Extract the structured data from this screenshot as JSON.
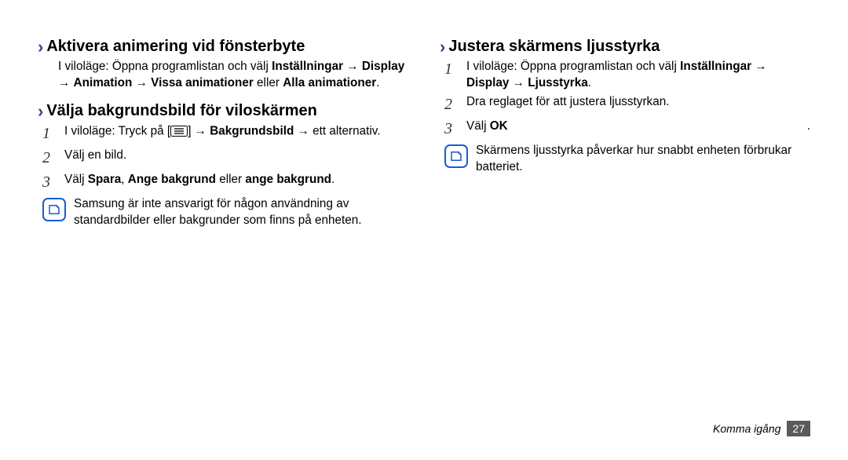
{
  "left": {
    "section1": {
      "title": "Aktivera animering vid fönsterbyte",
      "body_pre": "I viloläge: Öppna programlistan och välj ",
      "body_b1": "Inställningar",
      "arrow": " → ",
      "body_b2": "Display",
      "body_b3": "Animation",
      "body_b4": "Vissa animationer",
      "body_mid": " eller ",
      "body_b5": "Alla animationer",
      "body_end": "."
    },
    "section2": {
      "title": "Välja bakgrundsbild för viloskärmen",
      "step1_pre": "I viloläge: Tryck på [",
      "step1_post": "] → ",
      "step1_b1": "Bakgrundsbild",
      "step1_arrow": " → ",
      "step1_end": "ett alternativ.",
      "step2": "Välj en bild.",
      "step3_pre": "Välj ",
      "step3_b1": "Spara",
      "step3_sep": ", ",
      "step3_b2": "Ange bakgrund",
      "step3_mid": " eller ",
      "step3_b3": "ange bakgrund",
      "step3_end": ".",
      "note": "Samsung är inte ansvarigt för någon användning av standardbilder eller bakgrunder som finns på enheten."
    }
  },
  "right": {
    "section1": {
      "title": "Justera skärmens ljusstyrka",
      "step1_pre": "I viloläge: Öppna programlistan och välj ",
      "step1_b1": "Inställningar",
      "step1_arrow": " → ",
      "step1_b2": "Display",
      "step1_b3": "Ljusstyrka",
      "step1_end": ".",
      "step2": "Dra reglaget för att justera ljusstyrkan.",
      "step3_pre": "Välj ",
      "step3_b1": "OK",
      "step3_end": ".",
      "note": "Skärmens ljusstyrka påverkar hur snabbt enheten förbrukar batteriet."
    }
  },
  "nums": {
    "n1": "1",
    "n2": "2",
    "n3": "3"
  },
  "footer": {
    "label": "Komma igång",
    "page": "27"
  }
}
